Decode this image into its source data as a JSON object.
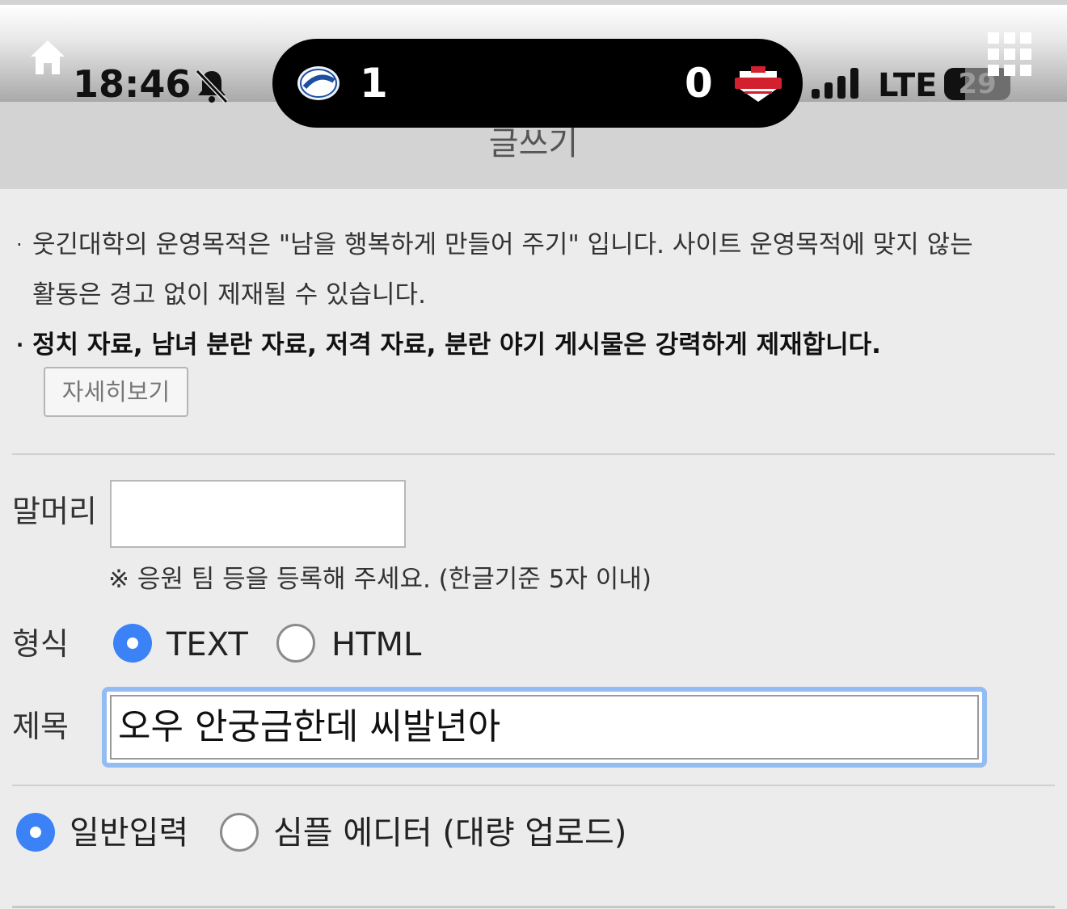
{
  "status_bar": {
    "time": "18:46",
    "network": "LTE",
    "battery_level": "29",
    "signal_bars": 3,
    "icons": [
      "home-icon",
      "bell-muted-icon",
      "signal-icon",
      "battery-icon",
      "grid-menu-icon"
    ]
  },
  "live_activity": {
    "home_team_logo": "lions-logo",
    "home_score": "1",
    "away_score": "0",
    "away_team_logo": "tigers-logo"
  },
  "header": {
    "title": "글쓰기"
  },
  "notice": {
    "line1": "웃긴대학의 운영목적은 \"남을 행복하게 만들어 주기\" 입니다. 사이트 운영목적에 맞지 않는",
    "line1_cont": "활동은 경고 없이 제재될 수 있습니다.",
    "line2": "정치 자료, 남녀 분란 자료, 저격 자료, 분란 야기 게시물은 강력하게 제재합니다.",
    "bullet": "·",
    "detail_button": "자세히보기"
  },
  "form": {
    "prefix_label": "말머리",
    "prefix_value": "",
    "prefix_hint": "※ 응원 팀 등을 등록해 주세요. (한글기준 5자 이내)",
    "format_label": "형식",
    "format_options": [
      {
        "label": "TEXT",
        "checked": true
      },
      {
        "label": "HTML",
        "checked": false
      }
    ],
    "subject_label": "제목",
    "subject_value": "오우 안궁금한데 씨발년아",
    "input_modes": [
      {
        "label": "일반입력",
        "checked": true
      },
      {
        "label": "심플 에디터 (대량 업로드)",
        "checked": false
      }
    ]
  },
  "colors": {
    "accent": "#3b82f6",
    "focus_ring": "#93bdf2",
    "background": "#ececec"
  }
}
